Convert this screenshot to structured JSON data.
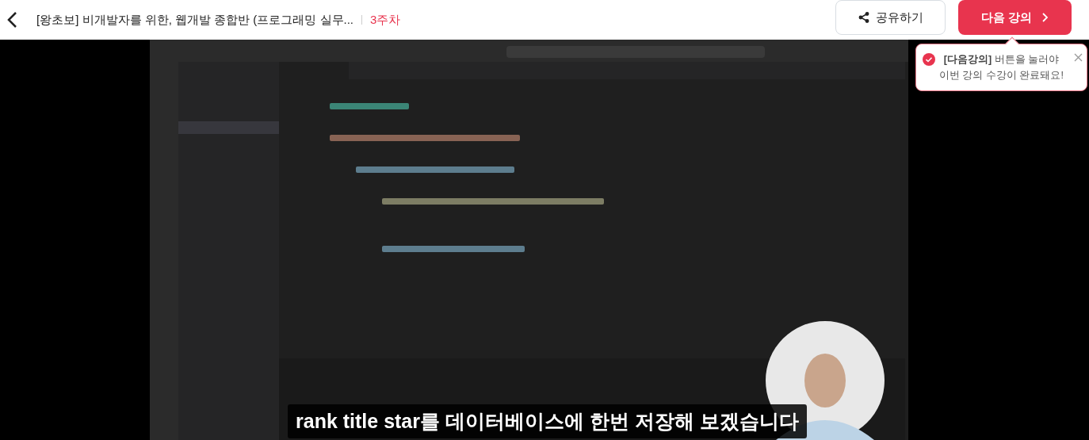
{
  "header": {
    "title": "[왕초보] 비개발자를 위한, 웹개발 종합반 (프로그래밍 실무...",
    "week": "3주차",
    "share_button": "공유하기",
    "next_button": "다음 강의"
  },
  "player": {
    "subtitle": "rank title star를 데이터베이스에 한번 저장해 보겠습니다"
  },
  "tooltip": {
    "text": "**[다음강의]** 버튼을 눌러야 이번 강의 수강이 완료돼요!"
  }
}
